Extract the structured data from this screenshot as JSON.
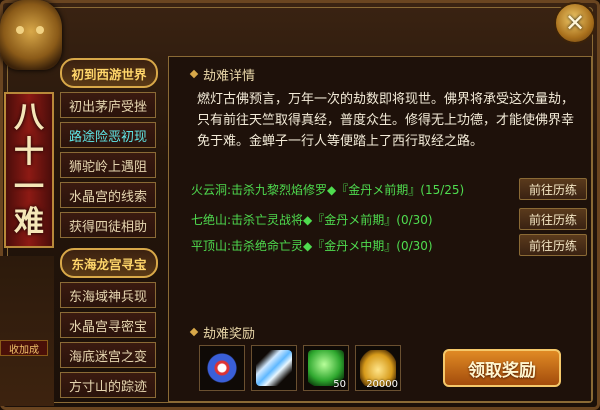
{
  "close_label": "✕",
  "vertical_title": [
    "八",
    "十",
    "一",
    "难"
  ],
  "side_label": "收加成",
  "chapters": [
    {
      "title": "初到西游世界",
      "items": [
        {
          "label": "初出茅庐受挫",
          "active": false
        },
        {
          "label": "路途险恶初现",
          "active": true
        },
        {
          "label": "狮驼岭上遇阻",
          "active": false
        },
        {
          "label": "水晶宫的线索",
          "active": false
        },
        {
          "label": "获得四徒相助",
          "active": false
        }
      ]
    },
    {
      "title": "东海龙宫寻宝",
      "items": [
        {
          "label": "东海域神兵现",
          "active": false
        },
        {
          "label": "水晶宫寻密宝",
          "active": false
        },
        {
          "label": "海底迷宫之变",
          "active": false
        },
        {
          "label": "方寸山的踪迹",
          "active": false
        }
      ]
    }
  ],
  "details": {
    "title": "劫难详情",
    "description": "燃灯古佛预言，万年一次的劫数即将现世。佛界将承受这次量劫，只有前往天竺取得真经，普度众生。修得无上功德，才能使佛界幸免于难。金蝉子一行人等便踏上了西行取经之路。"
  },
  "tasks": [
    {
      "text": "火云洞:击杀九黎烈焰修罗◆『金丹メ前期』(15/25)",
      "button": "前往历练"
    },
    {
      "text": "七绝山:击杀亡灵战将◆『金丹メ前期』(0/30)",
      "button": "前往历练"
    },
    {
      "text": "平顶山:击杀绝命亡灵◆『金丹メ中期』(0/30)",
      "button": "前往历练"
    }
  ],
  "rewards": {
    "title": "劫难奖励",
    "items": [
      {
        "icon": "spirit-orb-icon",
        "count": ""
      },
      {
        "icon": "blade-wing-icon",
        "count": ""
      },
      {
        "icon": "green-gem-icon",
        "count": "50"
      },
      {
        "icon": "gold-ingot-icon",
        "count": "20000"
      }
    ],
    "claim_label": "领取奖励"
  }
}
